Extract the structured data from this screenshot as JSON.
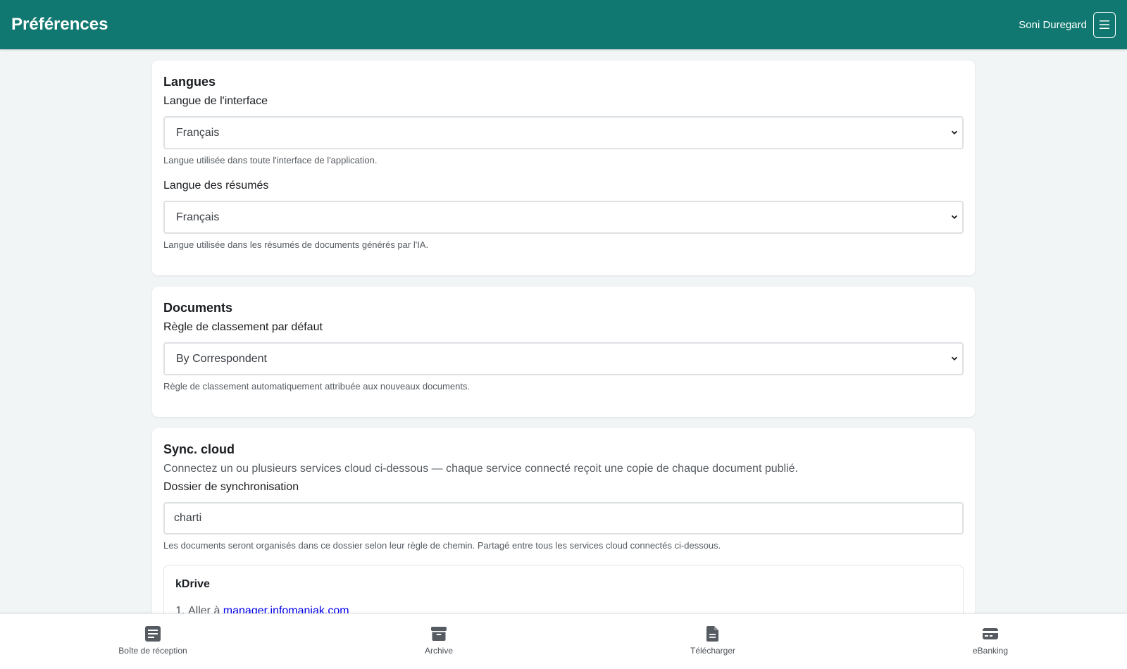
{
  "header": {
    "title": "Préférences",
    "user_name": "Soni Duregard"
  },
  "languages": {
    "title": "Langues",
    "interface": {
      "label": "Langue de l'interface",
      "value": "Français",
      "help": "Langue utilisée dans toute l'interface de l'application."
    },
    "summary": {
      "label": "Langue des résumés",
      "value": "Français",
      "help": "Langue utilisée dans les résumés de documents générés par l'IA."
    }
  },
  "documents": {
    "title": "Documents",
    "rule": {
      "label": "Règle de classement par défaut",
      "value": "By Correspondent",
      "help": "Règle de classement automatiquement attribuée aux nouveaux documents."
    }
  },
  "sync": {
    "title": "Sync. cloud",
    "intro": "Connectez un ou plusieurs services cloud ci-dessous — chaque service connecté reçoit une copie de chaque document publié.",
    "folder": {
      "label": "Dossier de synchronisation",
      "value": "charti",
      "help": "Les documents seront organisés dans ce dossier selon leur règle de chemin. Partagé entre tous les services cloud connectés ci-dessous."
    },
    "kdrive": {
      "title": "kDrive",
      "step1_prefix": "Aller à ",
      "step1_link": "manager.infomaniak.com"
    }
  },
  "bottom_nav": {
    "inbox": "Boîte de réception",
    "archive": "Archive",
    "upload": "Télécharger",
    "ebanking": "eBanking"
  },
  "colors": {
    "header_bg": "#107870",
    "page_bg": "#f1f5f6",
    "link": "#0000ee"
  }
}
